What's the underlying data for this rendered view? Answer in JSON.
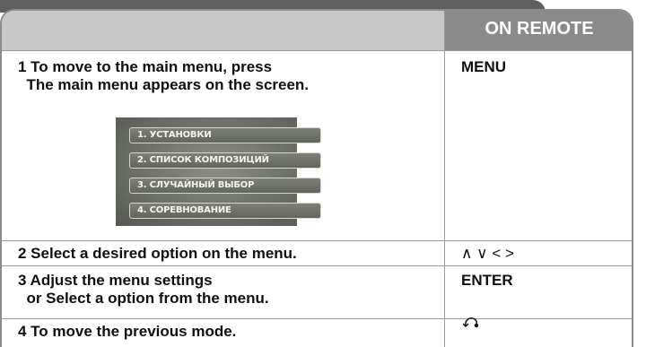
{
  "header": {
    "right_title": "ON REMOTE"
  },
  "rows": [
    {
      "step": "1 To move to the main menu, press",
      "step_line2": "  The main menu appears on the screen.",
      "remote": "MENU"
    },
    {
      "step": "2 Select a desired option on the menu.",
      "remote": "∧ ∨ < >"
    },
    {
      "step": "3 Adjust the menu settings",
      "step_line2": "  or Select a option from the menu.",
      "remote": "ENTER"
    },
    {
      "step": "4 To move the previous mode.",
      "remote_icon": "return-arrow-icon"
    }
  ],
  "menu_screenshot": {
    "items": [
      "1. УСТАНОВКИ",
      "2. СПИСОК КОМПОЗИЦИЙ",
      "3. СЛУЧАЙНЫЙ ВЫБОР",
      "4. СОРЕВНОВАНИЕ"
    ]
  }
}
